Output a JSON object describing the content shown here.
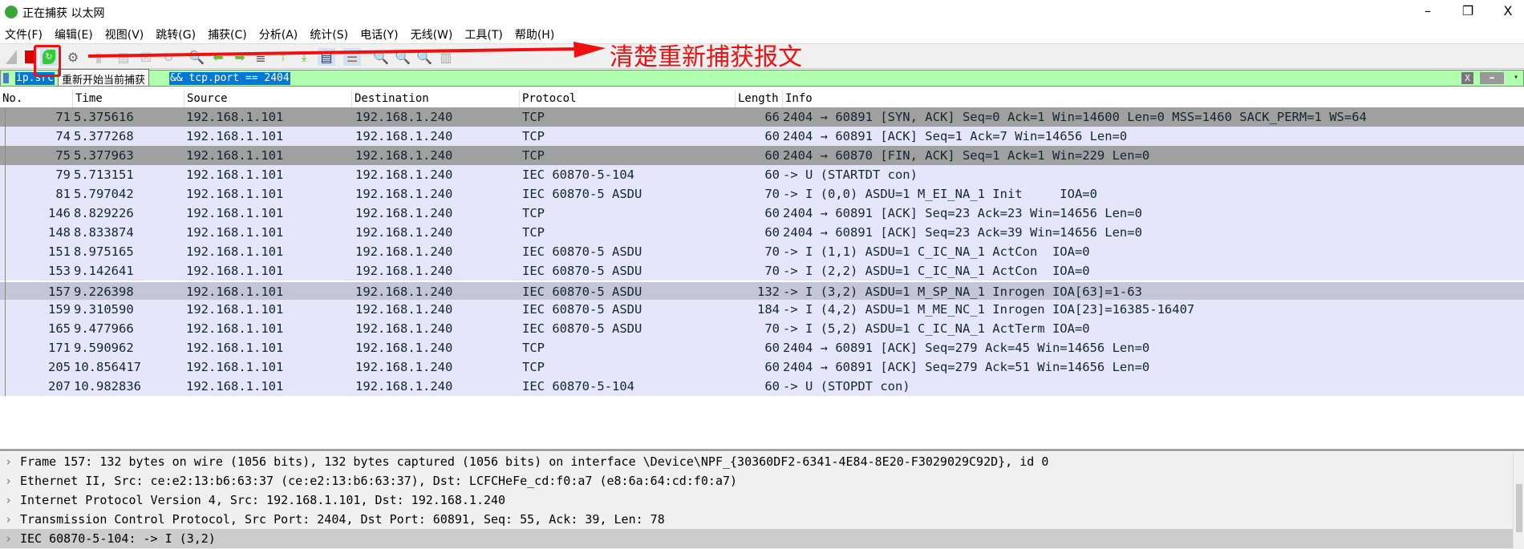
{
  "window": {
    "title": "正在捕获 以太网",
    "minimize": "–",
    "maximize": "❐",
    "close": "X"
  },
  "menu": [
    "文件(F)",
    "编辑(E)",
    "视图(V)",
    "跳转(G)",
    "捕获(C)",
    "分析(A)",
    "统计(S)",
    "电话(Y)",
    "无线(W)",
    "工具(T)",
    "帮助(H)"
  ],
  "annotation": {
    "text": "清楚重新捕获报文",
    "color": "#f01010"
  },
  "tooltip": "重新开始当前捕获",
  "filter": {
    "visible_prefix": "ip.src",
    "visible_suffix": "&& tcp.port == 2404",
    "clear": "X",
    "apply": "➡",
    "dropdown": "▾"
  },
  "columns": [
    "No.",
    "Time",
    "Source",
    "Destination",
    "Protocol",
    "Length",
    "Info"
  ],
  "packets": [
    {
      "no": "71",
      "time": "5.375616",
      "src": "192.168.1.101",
      "dst": "192.168.1.240",
      "proto": "TCP",
      "len": "66",
      "info": "2404 → 60891 [SYN, ACK] Seq=0 Ack=1 Win=14600 Len=0 MSS=1460 SACK_PERM=1 WS=64",
      "style": "gray"
    },
    {
      "no": "74",
      "time": "5.377268",
      "src": "192.168.1.101",
      "dst": "192.168.1.240",
      "proto": "TCP",
      "len": "60",
      "info": "2404 → 60891 [ACK] Seq=1 Ack=7 Win=14656 Len=0",
      "style": ""
    },
    {
      "no": "75",
      "time": "5.377963",
      "src": "192.168.1.101",
      "dst": "192.168.1.240",
      "proto": "TCP",
      "len": "60",
      "info": "2404 → 60870 [FIN, ACK] Seq=1 Ack=1 Win=229 Len=0",
      "style": "gray"
    },
    {
      "no": "79",
      "time": "5.713151",
      "src": "192.168.1.101",
      "dst": "192.168.1.240",
      "proto": "IEC 60870-5-104",
      "len": "60",
      "info": "-> U (STARTDT con)",
      "style": ""
    },
    {
      "no": "81",
      "time": "5.797042",
      "src": "192.168.1.101",
      "dst": "192.168.1.240",
      "proto": "IEC 60870-5 ASDU",
      "len": "70",
      "info": "-> I (0,0) ASDU=1 M_EI_NA_1 Init     IOA=0",
      "style": ""
    },
    {
      "no": "146",
      "time": "8.829226",
      "src": "192.168.1.101",
      "dst": "192.168.1.240",
      "proto": "TCP",
      "len": "60",
      "info": "2404 → 60891 [ACK] Seq=23 Ack=23 Win=14656 Len=0",
      "style": ""
    },
    {
      "no": "148",
      "time": "8.833874",
      "src": "192.168.1.101",
      "dst": "192.168.1.240",
      "proto": "TCP",
      "len": "60",
      "info": "2404 → 60891 [ACK] Seq=23 Ack=39 Win=14656 Len=0",
      "style": ""
    },
    {
      "no": "151",
      "time": "8.975165",
      "src": "192.168.1.101",
      "dst": "192.168.1.240",
      "proto": "IEC 60870-5 ASDU",
      "len": "70",
      "info": "-> I (1,1) ASDU=1 C_IC_NA_1 ActCon  IOA=0",
      "style": ""
    },
    {
      "no": "153",
      "time": "9.142641",
      "src": "192.168.1.101",
      "dst": "192.168.1.240",
      "proto": "IEC 60870-5 ASDU",
      "len": "70",
      "info": "-> I (2,2) ASDU=1 C_IC_NA_1 ActCon  IOA=0",
      "style": ""
    },
    {
      "no": "157",
      "time": "9.226398",
      "src": "192.168.1.101",
      "dst": "192.168.1.240",
      "proto": "IEC 60870-5 ASDU",
      "len": "132",
      "info": "-> I (3,2) ASDU=1 M_SP_NA_1 Inrogen IOA[63]=1-63",
      "style": "sel"
    },
    {
      "no": "159",
      "time": "9.310590",
      "src": "192.168.1.101",
      "dst": "192.168.1.240",
      "proto": "IEC 60870-5 ASDU",
      "len": "184",
      "info": "-> I (4,2) ASDU=1 M_ME_NC_1 Inrogen IOA[23]=16385-16407",
      "style": ""
    },
    {
      "no": "165",
      "time": "9.477966",
      "src": "192.168.1.101",
      "dst": "192.168.1.240",
      "proto": "IEC 60870-5 ASDU",
      "len": "70",
      "info": "-> I (5,2) ASDU=1 C_IC_NA_1 ActTerm IOA=0",
      "style": ""
    },
    {
      "no": "171",
      "time": "9.590962",
      "src": "192.168.1.101",
      "dst": "192.168.1.240",
      "proto": "TCP",
      "len": "60",
      "info": "2404 → 60891 [ACK] Seq=279 Ack=45 Win=14656 Len=0",
      "style": ""
    },
    {
      "no": "205",
      "time": "10.856417",
      "src": "192.168.1.101",
      "dst": "192.168.1.240",
      "proto": "TCP",
      "len": "60",
      "info": "2404 → 60891 [ACK] Seq=279 Ack=51 Win=14656 Len=0",
      "style": ""
    },
    {
      "no": "207",
      "time": "10.982836",
      "src": "192.168.1.101",
      "dst": "192.168.1.240",
      "proto": "IEC 60870-5-104",
      "len": "60",
      "info": "-> U (STOPDT con)",
      "style": ""
    }
  ],
  "details": [
    "Frame 157: 132 bytes on wire (1056 bits), 132 bytes captured (1056 bits) on interface \\Device\\NPF_{30360DF2-6341-4E84-8E20-F3029029C92D}, id 0",
    "Ethernet II, Src: ce:e2:13:b6:63:37 (ce:e2:13:b6:63:37), Dst: LCFCHeFe_cd:f0:a7 (e8:6a:64:cd:f0:a7)",
    "Internet Protocol Version 4, Src: 192.168.1.101, Dst: 192.168.1.240",
    "Transmission Control Protocol, Src Port: 2404, Dst Port: 60891, Seq: 55, Ack: 39, Len: 78",
    "IEC 60870-5-104: -> I (3,2)"
  ],
  "detail_chevron": "›"
}
